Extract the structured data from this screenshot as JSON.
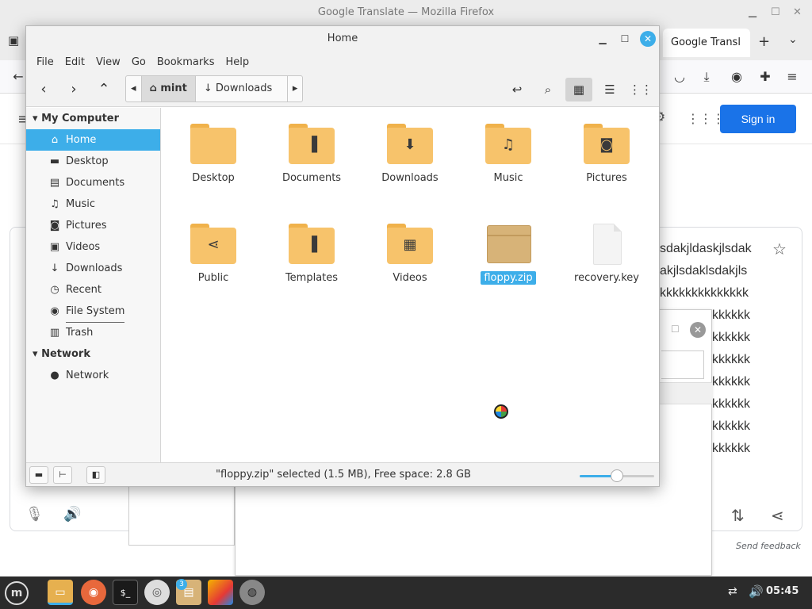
{
  "firefox": {
    "window_title": "Google Translate — Mozilla Firefox",
    "tab_title": "Google Transl",
    "new_tab_symbol": "+",
    "signin_label": "Sign in",
    "right_text_lines": [
      "sdakjldaskjlsdak",
      "akjlsdaklsdakjls",
      "kkkkkkkkkkkkkk",
      "kkkkkk",
      "kkkkkk",
      "kkkkkk",
      "kkkkkk",
      "kkkkkk",
      "kkkkkk",
      "kkkkkk"
    ],
    "send_feedback": "Send feedback"
  },
  "nemo": {
    "title": "Home",
    "menu": [
      "File",
      "Edit",
      "View",
      "Go",
      "Bookmarks",
      "Help"
    ],
    "pathbar": {
      "home_segment": "mint",
      "next_segment": "Downloads"
    },
    "sidebar": {
      "sections": [
        {
          "heading": "My Computer",
          "items": [
            {
              "label": "Home",
              "icon": "home-icon",
              "glyph": "⌂",
              "selected": true
            },
            {
              "label": "Desktop",
              "icon": "desktop-icon",
              "glyph": "▬"
            },
            {
              "label": "Documents",
              "icon": "documents-icon",
              "glyph": "▤"
            },
            {
              "label": "Music",
              "icon": "music-icon",
              "glyph": "♫"
            },
            {
              "label": "Pictures",
              "icon": "pictures-icon",
              "glyph": "◙"
            },
            {
              "label": "Videos",
              "icon": "videos-icon",
              "glyph": "▣"
            },
            {
              "label": "Downloads",
              "icon": "downloads-icon",
              "glyph": "↓"
            },
            {
              "label": "Recent",
              "icon": "recent-icon",
              "glyph": "◷"
            },
            {
              "label": "File System",
              "icon": "filesystem-icon",
              "glyph": "◉"
            },
            {
              "label": "Trash",
              "icon": "trash-icon",
              "glyph": "▥"
            }
          ]
        },
        {
          "heading": "Network",
          "items": [
            {
              "label": "Network",
              "icon": "network-icon",
              "glyph": "●"
            }
          ]
        }
      ]
    },
    "files": [
      {
        "name": "Desktop",
        "kind": "folder",
        "glyph": ""
      },
      {
        "name": "Documents",
        "kind": "folder",
        "glyph": "▐"
      },
      {
        "name": "Downloads",
        "kind": "folder",
        "glyph": "⬇"
      },
      {
        "name": "Music",
        "kind": "folder",
        "glyph": "♫"
      },
      {
        "name": "Pictures",
        "kind": "folder",
        "glyph": "◙"
      },
      {
        "name": "Public",
        "kind": "folder",
        "glyph": "⋖"
      },
      {
        "name": "Templates",
        "kind": "folder",
        "glyph": "▐"
      },
      {
        "name": "Videos",
        "kind": "folder",
        "glyph": "▦"
      },
      {
        "name": "floppy.zip",
        "kind": "zip",
        "selected": true
      },
      {
        "name": "recovery.key",
        "kind": "file"
      }
    ],
    "status_text": "\"floppy.zip\" selected (1.5 MB), Free space: 2.8 GB",
    "zoom_level_fraction": 0.5
  },
  "taskbar": {
    "badge_count": "3",
    "clock": "05:45"
  },
  "colors": {
    "accent": "#3daee9",
    "folder": "#f7c36b",
    "signin": "#1a73e8"
  }
}
